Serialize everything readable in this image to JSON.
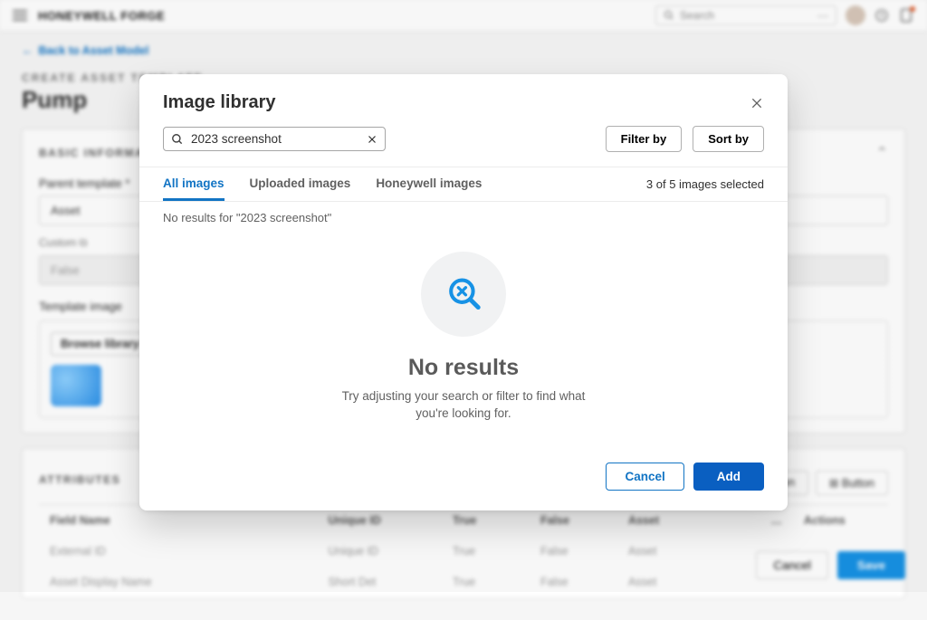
{
  "topbar": {
    "brand": "HONEYWELL FORGE",
    "search_placeholder": "Search"
  },
  "page": {
    "back_label": "Back to Asset Model",
    "overline": "CREATE ASSET TEMPLATE",
    "title": "Pump"
  },
  "basic": {
    "heading": "BASIC INFORMATION",
    "parent_label": "Parent template",
    "parent_value": "Asset",
    "custom_label": "Custom",
    "custom_value": "False",
    "template_image_label": "Template image",
    "browse_label": "Browse library"
  },
  "attributes": {
    "heading": "ATTRIBUTES",
    "button1": "Button",
    "button2": "Button",
    "columns": [
      "Field Name",
      "",
      "Unique ID",
      "True",
      "False",
      "Asset",
      "",
      "Actions"
    ],
    "rows": [
      [
        "External ID",
        "",
        "Unique ID",
        "True",
        "False",
        "Asset",
        "",
        ""
      ],
      [
        "Asset Display Name",
        "",
        "Short Det",
        "True",
        "False",
        "Asset",
        "",
        ""
      ]
    ]
  },
  "bg_footer": {
    "cancel": "Cancel",
    "save": "Save"
  },
  "modal": {
    "title": "Image library",
    "search_value": "2023 screenshot",
    "filter_label": "Filter by",
    "sort_label": "Sort by",
    "tabs": [
      "All images",
      "Uploaded images",
      "Honeywell images"
    ],
    "selection_count": "3 of 5 images selected",
    "no_results_line": "No results for \"2023 screenshot\"",
    "empty_title": "No results",
    "empty_sub": "Try adjusting your search or filter to find what you're looking for.",
    "cancel": "Cancel",
    "add": "Add"
  }
}
